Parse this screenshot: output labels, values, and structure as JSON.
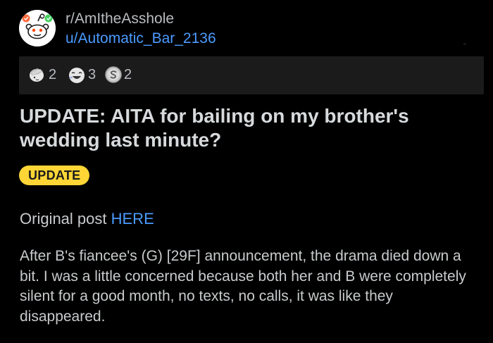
{
  "header": {
    "subreddit": "r/AmItheAsshole",
    "username": "u/Automatic_Bar_2136"
  },
  "awards": [
    {
      "icon": "facepalm-award-icon",
      "count": "2"
    },
    {
      "icon": "laughing-award-icon",
      "count": "3"
    },
    {
      "icon": "silver-award-icon",
      "count": "2"
    }
  ],
  "post": {
    "title": "UPDATE: AITA for bailing on my brother's wedding last minute?",
    "flair": "UPDATE",
    "original_prefix": "Original post ",
    "original_link": "HERE",
    "body": "After B's fiancee's (G) [29F] announcement, the drama died down a bit. I was a little concerned because both her and B were completely silent for a good month, no texts, no calls, it was like they disappeared."
  },
  "colors": {
    "background": "#000000",
    "link": "#4b9bff",
    "flair_bg": "#ffd635",
    "award_bar": "#1b1b1c"
  }
}
